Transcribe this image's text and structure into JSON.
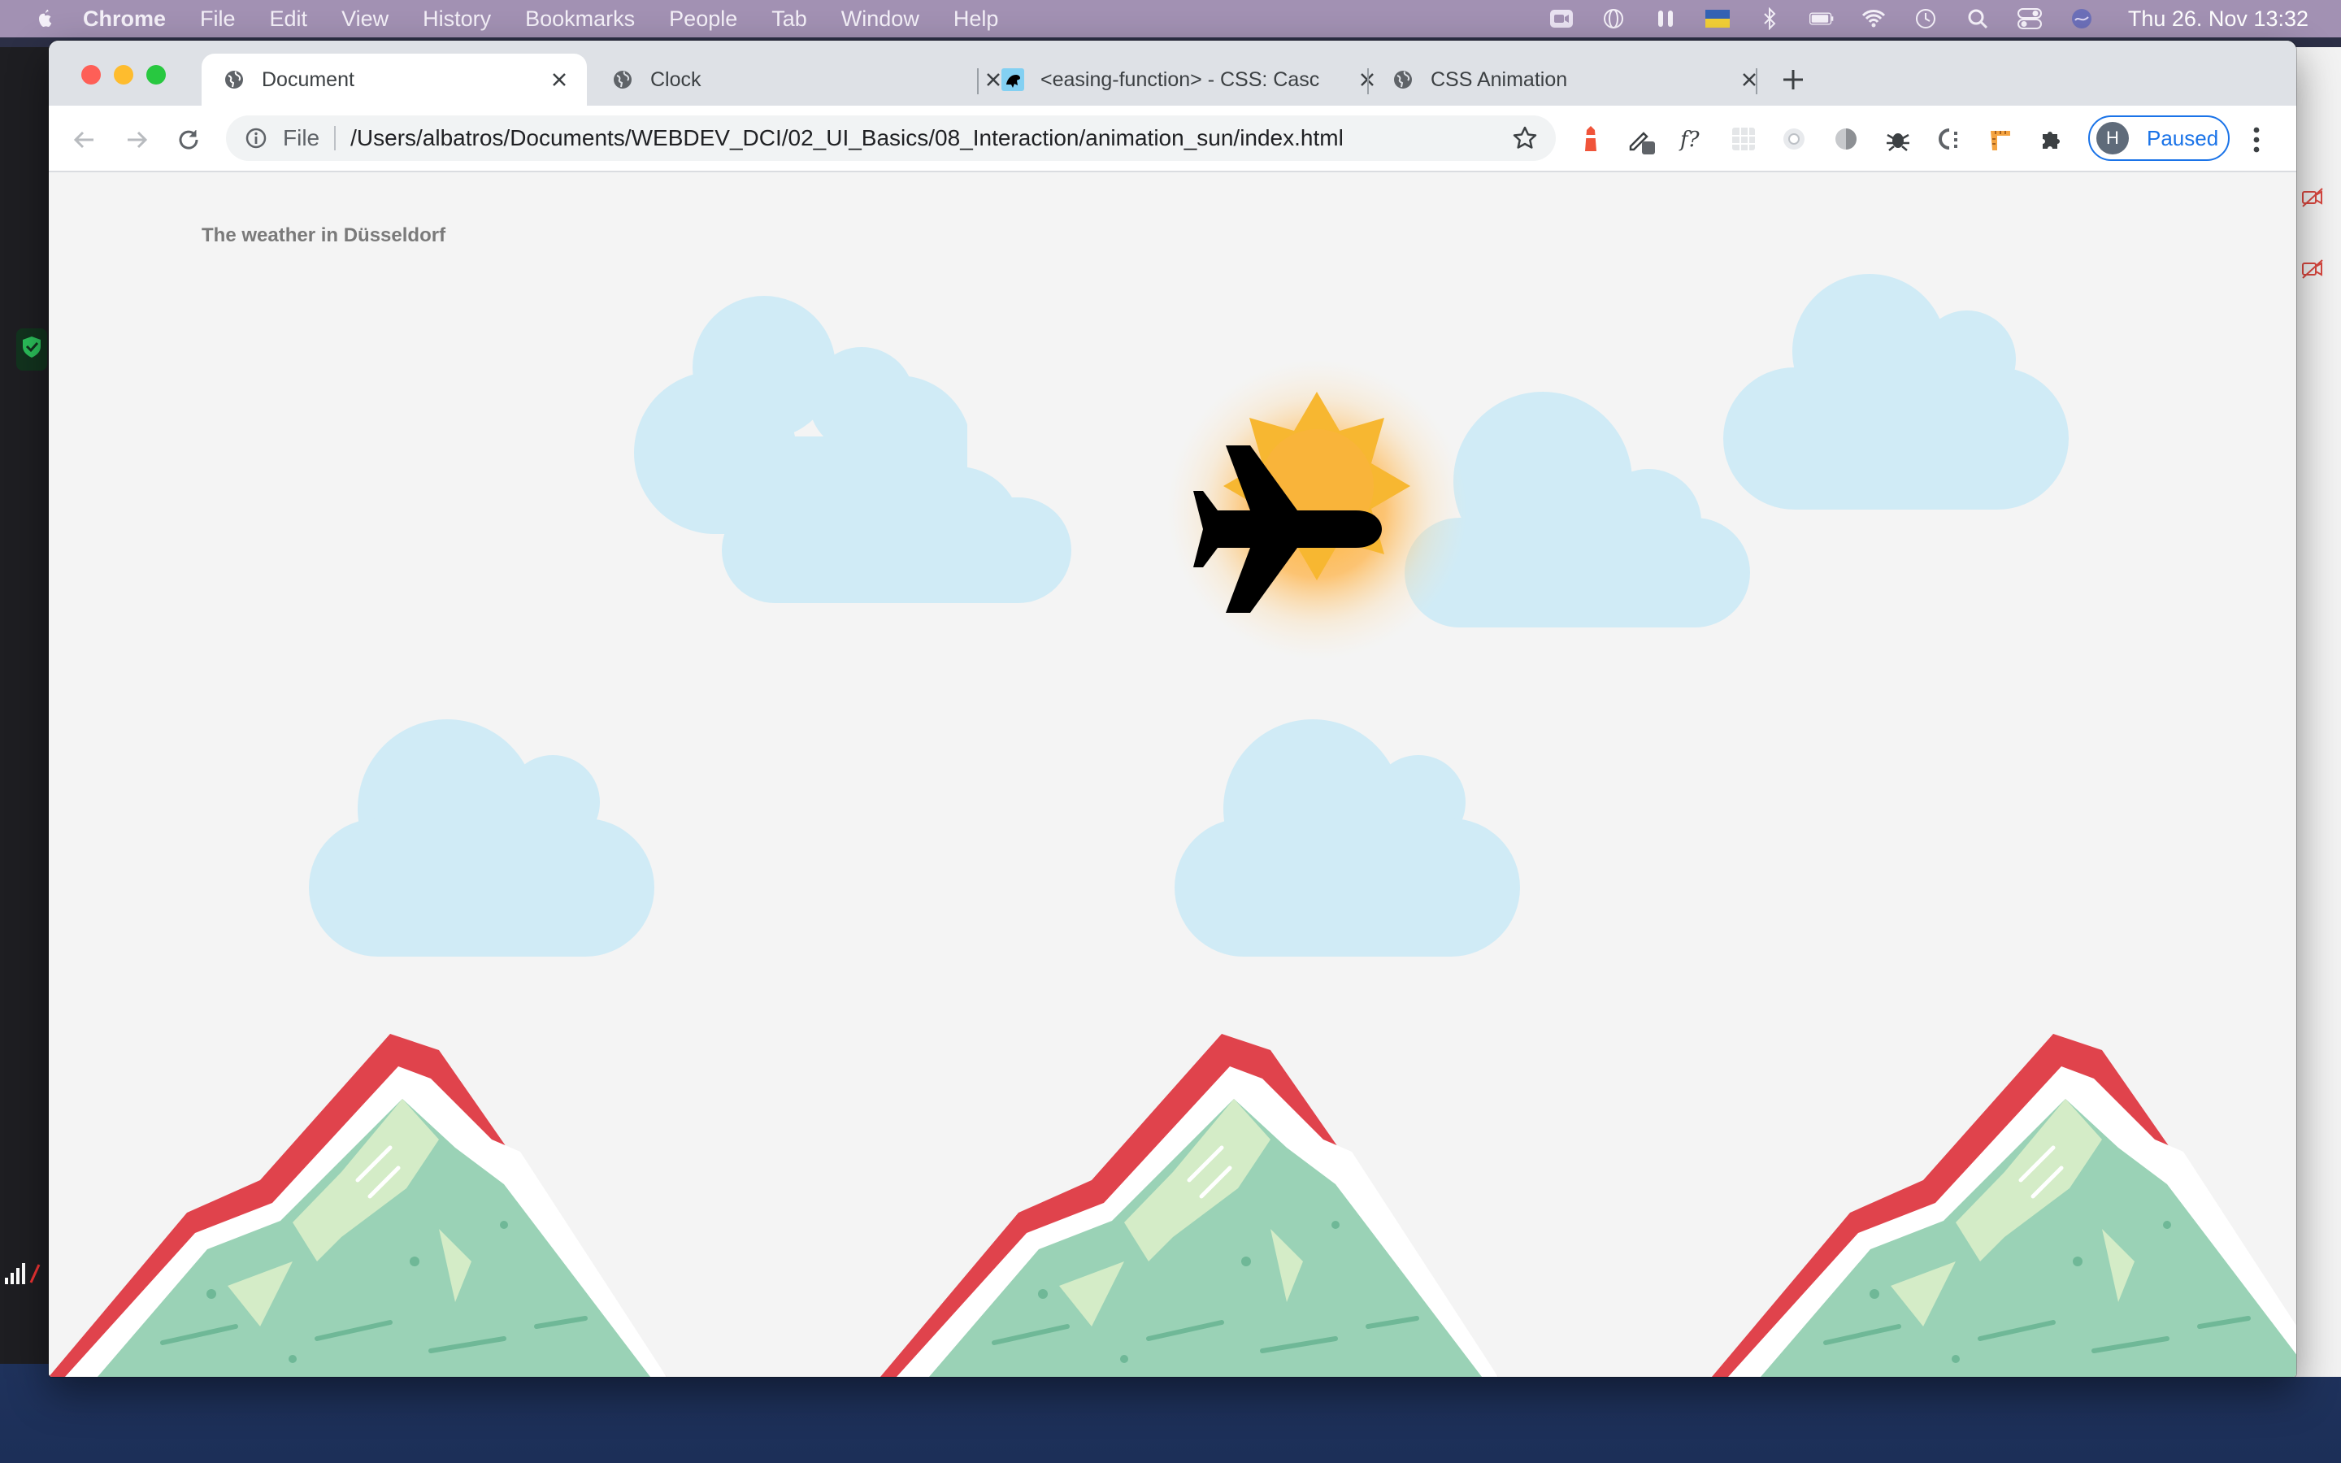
{
  "menubar": {
    "app": "Chrome",
    "items": [
      "File",
      "Edit",
      "View",
      "History",
      "Bookmarks",
      "People",
      "Tab",
      "Window",
      "Help"
    ],
    "datetime": "Thu 26. Nov  13:32"
  },
  "tabs": [
    {
      "label": "Document",
      "icon": "globe-icon",
      "active": true
    },
    {
      "label": "Clock",
      "icon": "globe-icon",
      "active": false
    },
    {
      "label": "<easing-function> - CSS: Casc",
      "icon": "mdn-icon",
      "active": false
    },
    {
      "label": "CSS Animation",
      "icon": "globe-icon",
      "active": false
    }
  ],
  "omnibox": {
    "scheme": "File",
    "url": "/Users/albatros/Documents/WEBDEV_DCI/02_UI_Basics/08_Interaction/animation_sun/index.html"
  },
  "profile": {
    "initial": "H",
    "status": "Paused"
  },
  "page": {
    "title": "The weather in Düsseldorf"
  },
  "colors": {
    "cloud": "#d0ebf6",
    "sun": "#f7b731",
    "mountain_red": "#e0434c",
    "mountain_green": "#9ad2b6",
    "page_bg": "#f4f4f4",
    "accent": "#1a73e8"
  }
}
